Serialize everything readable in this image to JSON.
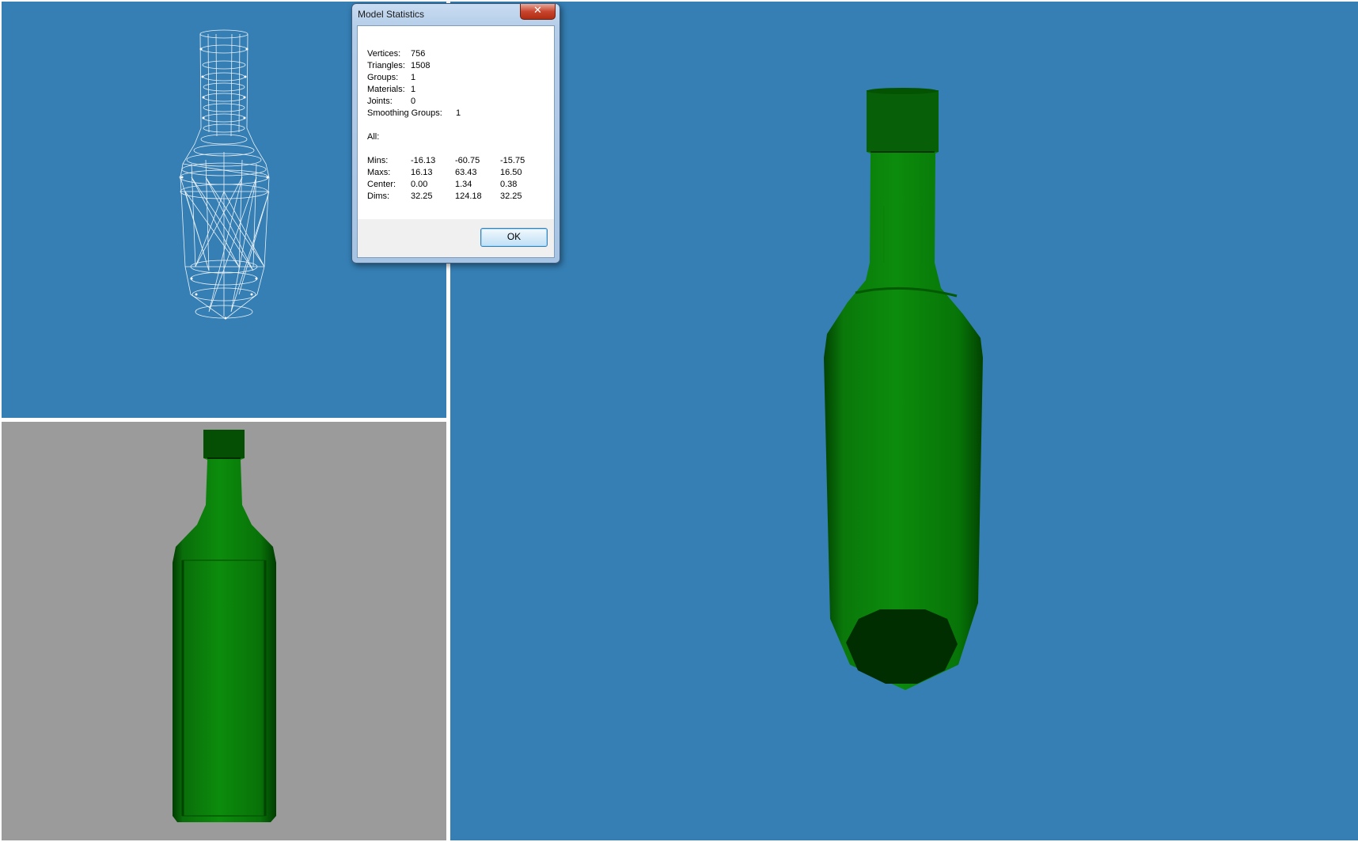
{
  "dialog": {
    "title": "Model Statistics",
    "close_glyph": "✕",
    "ok_label": "OK",
    "counts": [
      {
        "label": "Vertices:",
        "value": "756"
      },
      {
        "label": "Triangles:",
        "value": "1508"
      },
      {
        "label": "Groups:",
        "value": "1"
      },
      {
        "label": "Materials:",
        "value": "1"
      },
      {
        "label": "Joints:",
        "value": "0"
      },
      {
        "label": "Smoothing Groups:",
        "value": "1"
      }
    ],
    "section_label": "All:",
    "bounds": [
      {
        "label": "Mins:",
        "x": "-16.13",
        "y": "-60.75",
        "z": "-15.75"
      },
      {
        "label": "Maxs:",
        "x": "16.13",
        "y": "63.43",
        "z": "16.50"
      },
      {
        "label": "Center:",
        "x": "0.00",
        "y": "1.34",
        "z": "0.38"
      },
      {
        "label": "Dims:",
        "x": "32.25",
        "y": "124.18",
        "z": "32.25"
      }
    ]
  },
  "colors": {
    "viewport_blue": "#357fb5",
    "viewport_gray": "#9b9b9b",
    "bottle_green": "#0a8a0a",
    "bottle_dark": "#003a00",
    "wireframe": "#ffffff"
  }
}
